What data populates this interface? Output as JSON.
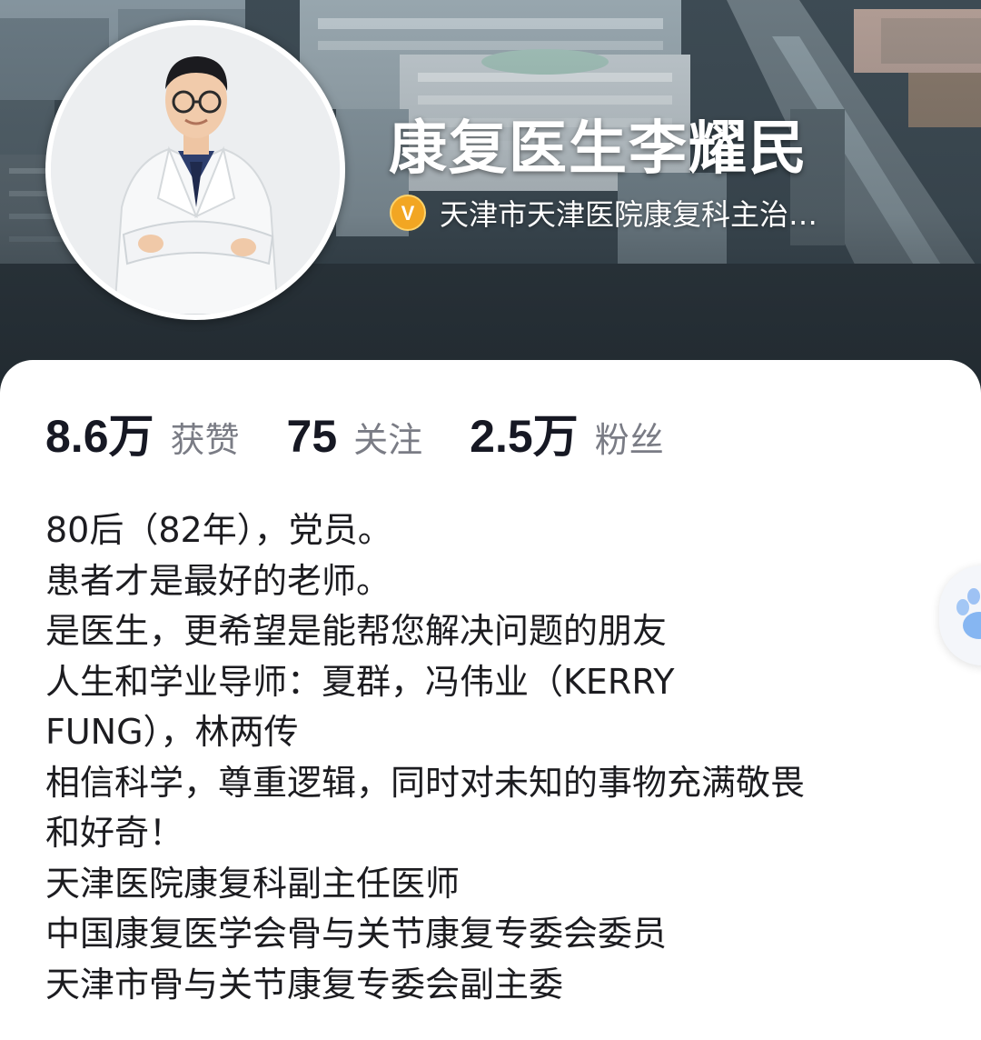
{
  "profile": {
    "name": "康复医生李耀民",
    "verification": "天津市天津医院康复科主治…",
    "verify_badge_letter": "V",
    "verify_badge_color": "#f2a623"
  },
  "stats": [
    {
      "value": "8.6万",
      "label": "获赞"
    },
    {
      "value": "75",
      "label": "关注"
    },
    {
      "value": "2.5万",
      "label": "粉丝"
    }
  ],
  "bio": [
    "80后（82年），党员。",
    "患者才是最好的老师。",
    "是医生，更希望是能帮您解决问题的朋友",
    "人生和学业导师：夏群，冯伟业（KERRY",
    "FUNG），林两传",
    "相信科学，尊重逻辑，同时对未知的事物充满敬畏",
    "和好奇！",
    "天津医院康复科副主任医师",
    "中国康复医学会骨与关节康复专委会委员",
    "天津市骨与关节康复专委会副主委"
  ],
  "icons": {
    "avatar": "doctor-portrait",
    "badge": "verified-v-icon",
    "floating": "paw-icon"
  },
  "colors": {
    "card_bg": "#ffffff",
    "stat_number": "#161823",
    "stat_label": "#7a7c85",
    "bio_text": "#1c1c20",
    "float_icon": "#7fb0f0"
  }
}
